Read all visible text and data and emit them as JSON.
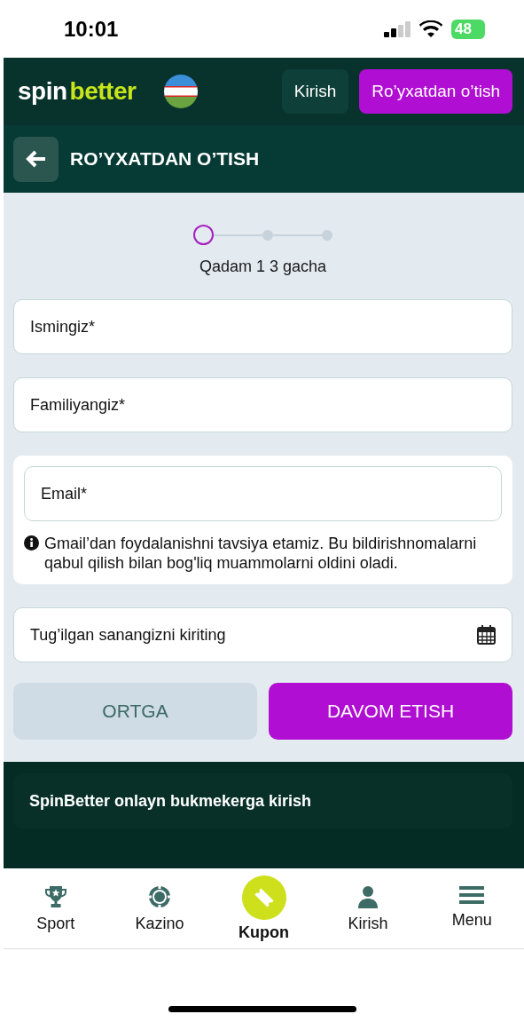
{
  "status_bar": {
    "time": "10:01",
    "battery": "48"
  },
  "header": {
    "logo": [
      "spin",
      "better"
    ],
    "buttons": [
      {
        "label": "Kirish",
        "kind": "secondary"
      },
      {
        "label": "Ro’yxatdan o’tish",
        "kind": "primary"
      }
    ]
  },
  "subheader": {
    "title": "RO’YXATDAN O’TISH"
  },
  "stepper": {
    "steps": [
      {
        "selected": true
      },
      {
        "selected": false
      },
      {
        "selected": false
      }
    ],
    "caption": "Qadam 1 3 gacha"
  },
  "fields": [
    {
      "kind": "text",
      "placeholder": "Ismingiz*"
    },
    {
      "kind": "text",
      "placeholder": "Familiyangiz*"
    },
    {
      "kind": "email",
      "placeholder": "Email*",
      "hint": "Gmail’dan foydalanishni tavsiya etamiz. Bu bildirishnomalarni qabul qilish bilan bog'liq muammolarni oldini oladi."
    },
    {
      "kind": "date",
      "placeholder": "Tug’ilgan sanangizni kiriting"
    }
  ],
  "actions": [
    {
      "label": "ORTGA",
      "kind": "secondary"
    },
    {
      "label": "DAVOM ETISH",
      "kind": "primary"
    }
  ],
  "info_panel": {
    "title": "SpinBetter onlayn bukmekerga kirish"
  },
  "bottom_nav": [
    {
      "label": "Sport",
      "kind": "tab"
    },
    {
      "label": "Kazino",
      "kind": "tab"
    },
    {
      "label": "Kupon",
      "kind": "center"
    },
    {
      "label": "Kirish",
      "kind": "tab"
    },
    {
      "label": "Menu",
      "kind": "tab"
    }
  ]
}
